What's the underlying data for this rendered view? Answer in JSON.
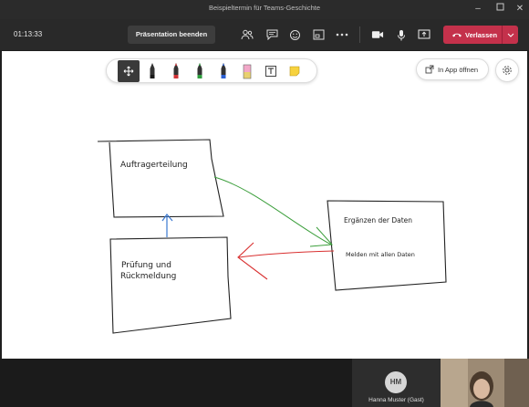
{
  "window": {
    "title": "Beispieltermin für Teams-Geschichte",
    "controls": [
      "minimize-icon",
      "maximize-icon",
      "close-icon"
    ]
  },
  "toolbar": {
    "timer": "01:13:33",
    "end_presentation_label": "Präsentation beenden",
    "icons": [
      "participants-icon",
      "chat-icon",
      "reactions-icon",
      "breakout-rooms-icon",
      "more-icon",
      "camera-icon",
      "microphone-icon",
      "share-icon"
    ],
    "leave_label": "Verlassen",
    "leave_color": "#c4314b"
  },
  "whiteboard": {
    "tools": [
      {
        "name": "move-tool-icon",
        "active": true
      },
      {
        "name": "pen-black-icon",
        "color": "#1a1a1a"
      },
      {
        "name": "pen-red-icon",
        "color": "#d13438"
      },
      {
        "name": "pen-green-icon",
        "color": "#2e9e3e"
      },
      {
        "name": "pen-blue-icon",
        "color": "#2b5fd1"
      },
      {
        "name": "highlighter-icon",
        "color": "#f2a7c8"
      },
      {
        "name": "text-tool-icon"
      },
      {
        "name": "sticky-note-icon",
        "color": "#f7d23e"
      }
    ],
    "open_in_app_label": "In App öffnen",
    "settings_icon": "gear-icon",
    "boxes": {
      "auftrag": "Auftragerteilung",
      "pruefung_line1": "Prüfung und",
      "pruefung_line2": "Rückmeldung",
      "daten_line1": "Ergänzen der Daten",
      "daten_line2": "Melden mit allen Daten"
    },
    "arrow_colors": {
      "green": "#3a9e3a",
      "red": "#d93030",
      "blue": "#3a78d0"
    }
  },
  "participants": [
    {
      "initials": "HM",
      "name": "Hanna Muster (Gast)"
    }
  ]
}
